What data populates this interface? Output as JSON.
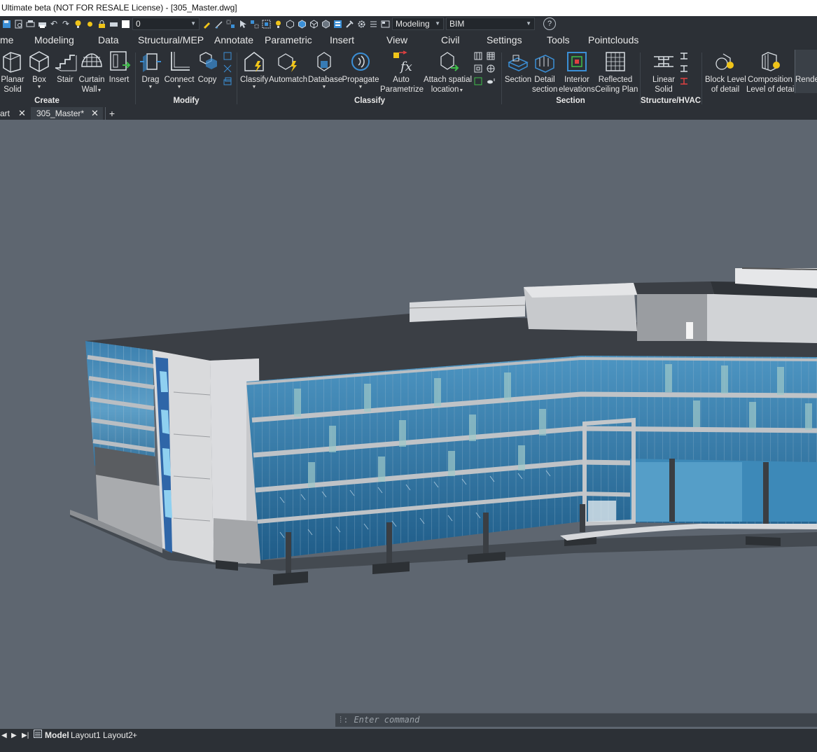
{
  "window": {
    "title": "Ultimate beta (NOT FOR RESALE License) - [305_Master.dwg]"
  },
  "quick_access": {
    "layer_value": "0",
    "workspace_value": "Modeling",
    "profile_value": "BIM",
    "help_icon": "help-icon"
  },
  "menu": {
    "tabs": [
      "me",
      "Modeling",
      "Data",
      "Structural/MEP",
      "Annotate",
      "Parametric",
      "Insert",
      "View",
      "Civil",
      "Settings",
      "Tools",
      "Pointclouds"
    ],
    "active": "Modeling"
  },
  "ribbon": {
    "buttons": {
      "planar_solid": [
        "Planar",
        "Solid"
      ],
      "box": "Box",
      "stair": "Stair",
      "curtain_wall": [
        "Curtain",
        "Wall"
      ],
      "insert": "Insert",
      "drag": "Drag",
      "connect": "Connect",
      "copy": "Copy",
      "classify": "Classify",
      "automatch": "Automatch",
      "database": "Database",
      "propagate": "Propagate",
      "auto_parametrize": [
        "Auto",
        "Parametrize"
      ],
      "attach_spatial": [
        "Attach spatial",
        "location"
      ],
      "section": "Section",
      "detail_section": [
        "Detail",
        "section"
      ],
      "interior_elevations": [
        "Interior",
        "elevations"
      ],
      "reflected_ceiling": [
        "Reflected",
        "Ceiling Plan"
      ],
      "linear_solid": [
        "Linear",
        "Solid"
      ],
      "block_level": [
        "Block Level",
        "of detail"
      ],
      "composition_level": [
        "Composition",
        "Level of detail"
      ],
      "render": "Rende"
    },
    "groups": [
      "Create",
      "Modify",
      "Classify",
      "Section",
      "Structure/HVAC"
    ]
  },
  "doc_tabs": [
    {
      "label": "art"
    },
    {
      "label": "305_Master*",
      "active": true
    }
  ],
  "command": {
    "placeholder": "Enter command"
  },
  "layouts": {
    "items": [
      "Model",
      "Layout1",
      "Layout2"
    ],
    "active": "Model",
    "add": "+"
  },
  "colors": {
    "ui_dark": "#2c3036",
    "viewport": "#5e6670",
    "accent_blue": "#3b8fd6"
  }
}
